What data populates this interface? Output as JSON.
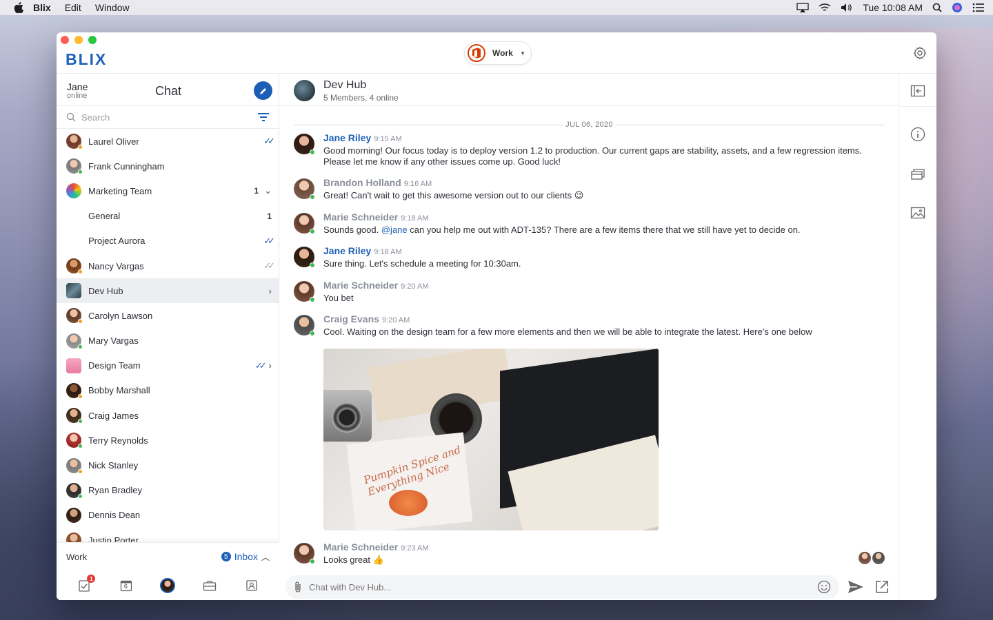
{
  "menubar": {
    "app": "Blix",
    "items": [
      "Edit",
      "Window"
    ],
    "clock": "Tue 10:08 AM"
  },
  "app": {
    "logo": "BLIX",
    "account_label": "Work"
  },
  "sidebar": {
    "user_name": "Jane",
    "user_status": "online",
    "title": "Chat",
    "search_placeholder": "Search",
    "items": [
      {
        "label": "Laurel Oliver",
        "check": "read"
      },
      {
        "label": "Frank Cunningham"
      },
      {
        "label": "Marketing Team",
        "count": "1"
      },
      {
        "label": "General",
        "count": "1"
      },
      {
        "label": "Project Aurora",
        "check": "read"
      },
      {
        "label": "Nancy Vargas",
        "check": "grey"
      },
      {
        "label": "Dev Hub"
      },
      {
        "label": "Carolyn Lawson"
      },
      {
        "label": "Mary Vargas"
      },
      {
        "label": "Design Team",
        "check": "read"
      },
      {
        "label": "Bobby Marshall"
      },
      {
        "label": "Craig James"
      },
      {
        "label": "Terry Reynolds"
      },
      {
        "label": "Nick Stanley"
      },
      {
        "label": "Ryan Bradley"
      },
      {
        "label": "Dennis Dean"
      },
      {
        "label": "Justin Porter"
      }
    ],
    "footer": {
      "account": "Work",
      "inbox_count": "5",
      "inbox_label": "Inbox",
      "tasks_badge": "1",
      "calendar_day": "6"
    }
  },
  "conversation": {
    "name": "Dev Hub",
    "subtitle": "5 Members, 4 online",
    "date": "JUL 06, 2020",
    "messages": [
      {
        "sender": "Jane Riley",
        "time": "9:15 AM",
        "text": "Good morning! Our focus today is to deploy version 1.2 to production. Our current gaps are stability, assets, and a few regression items. Please let me know if any other issues come up. Good luck!"
      },
      {
        "sender": "Brandon Holland",
        "time": "9:16 AM",
        "text": "Great! Can't wait to get this awesome version out to our clients 😉"
      },
      {
        "sender": "Marie Schneider",
        "time": "9:18 AM",
        "mention": "@jane",
        "text_before": "Sounds good. ",
        "text_after": " can you help me out with ADT-135? There are a few items there that we still have yet to decide on."
      },
      {
        "sender": "Jane Riley",
        "time": "9:18 AM",
        "text": "Sure thing. Let's schedule a meeting for 10:30am."
      },
      {
        "sender": "Marie Schneider",
        "time": "9:20 AM",
        "text": "You bet"
      },
      {
        "sender": "Craig Evans",
        "time": "9:20 AM",
        "text": "Cool. Waiting on the design team for a few more elements and then we will be able to integrate the latest. Here's one below"
      },
      {
        "sender": "Marie Schneider",
        "time": "9:23 AM",
        "text": "Looks great 👍"
      }
    ],
    "image_caption_text": "Pumpkin Spice and Everything Nice",
    "composer_placeholder": "Chat with Dev Hub..."
  },
  "colors": {
    "accent": "#1d5fb6",
    "online": "#3fb950",
    "selected_row": "#eceef2",
    "badge": "#e53935"
  }
}
